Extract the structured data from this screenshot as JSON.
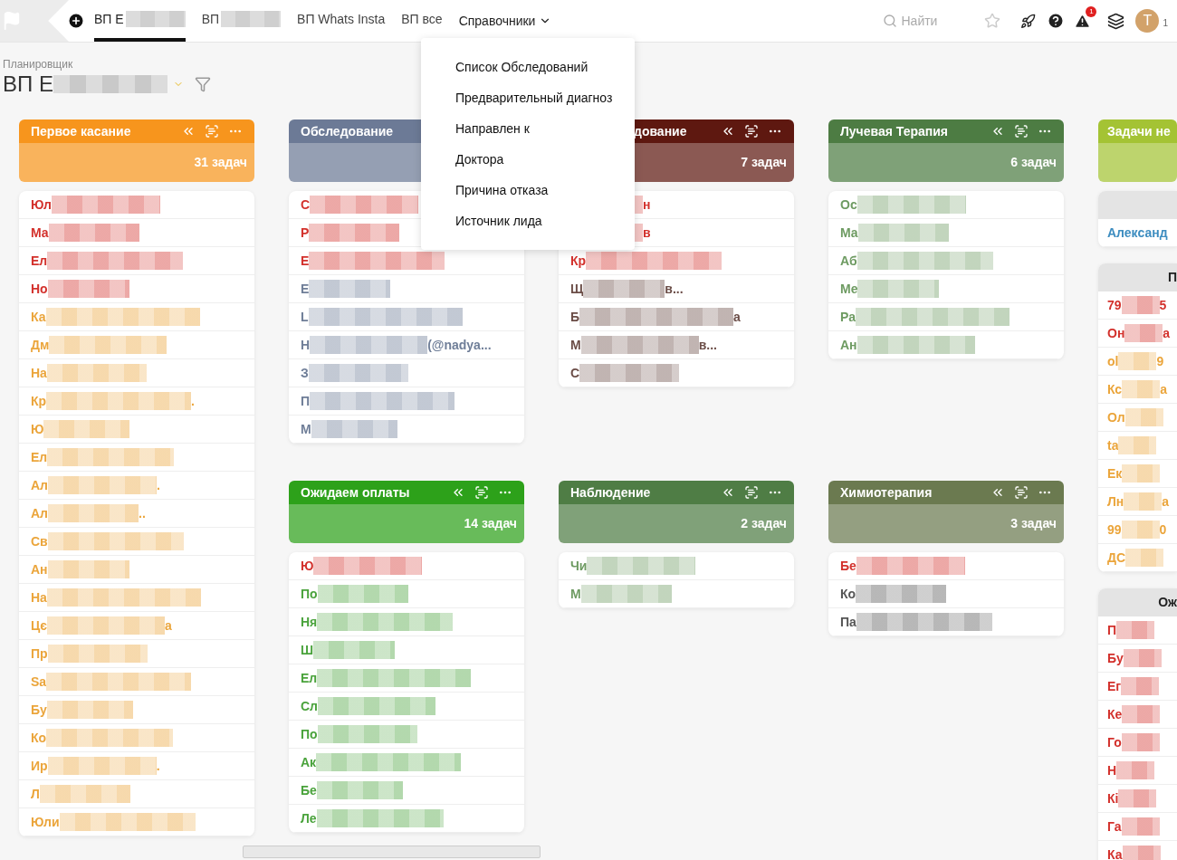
{
  "nav": {
    "tabs": [
      {
        "label": "ВП Е",
        "selected": true,
        "masked": true
      },
      {
        "label": "ВП",
        "selected": false,
        "masked": true
      },
      {
        "label": "ВП Whats Insta",
        "selected": false,
        "masked": false
      },
      {
        "label": "ВП все",
        "selected": false,
        "masked": false
      }
    ],
    "menu_label": "Справочники",
    "menu_open": true,
    "search_placeholder": "Найти",
    "alert_badge": "1",
    "avatar": "T",
    "user_count": "1"
  },
  "planner": {
    "caption": "Планировщик",
    "title": "ВП Е",
    "masked": true
  },
  "dropdown": {
    "items": [
      "Список Обследований",
      "Предварительный диагноз",
      "Направлен к",
      "Доктора",
      "Причина отказа",
      "Источник лида"
    ]
  },
  "columns": [
    {
      "stacks": [
        {
          "kind": "stage",
          "title": "Первое касание",
          "count": "31 задач",
          "color": "#f7951d",
          "rows": [
            {
              "text": "Юл",
              "color": "#d3312c",
              "masked": true
            },
            {
              "text": "Ма",
              "color": "#d3312c",
              "masked": true
            },
            {
              "text": "Ел",
              "color": "#d3312c",
              "masked": true
            },
            {
              "text": "Но",
              "color": "#d3312c",
              "masked": true
            },
            {
              "text": "Ка",
              "color": "#eba53b",
              "masked": true
            },
            {
              "text": "Дм",
              "color": "#eba53b",
              "masked": true
            },
            {
              "text": "На",
              "color": "#eba53b",
              "masked": true
            },
            {
              "text": "Кр",
              "color": "#eba53b",
              "masked": true,
              "tail": "."
            },
            {
              "text": "Ю",
              "color": "#eba53b",
              "masked": true
            },
            {
              "text": "Ел",
              "color": "#eba53b",
              "masked": true
            },
            {
              "text": "Ал",
              "color": "#eba53b",
              "masked": true,
              "tail": "."
            },
            {
              "text": "Ал",
              "color": "#eba53b",
              "masked": true,
              "tail": ".."
            },
            {
              "text": "Св",
              "color": "#eba53b",
              "masked": true
            },
            {
              "text": "Ан",
              "color": "#eba53b",
              "masked": true
            },
            {
              "text": "На",
              "color": "#eba53b",
              "masked": true
            },
            {
              "text": "Цє",
              "color": "#eba53b",
              "masked": true,
              "tail": "а"
            },
            {
              "text": "Пр",
              "color": "#eba53b",
              "masked": true
            },
            {
              "text": "Sa",
              "color": "#eba53b",
              "masked": true
            },
            {
              "text": "Бу",
              "color": "#eba53b",
              "masked": true
            },
            {
              "text": "Ко",
              "color": "#eba53b",
              "masked": true
            },
            {
              "text": "Ир",
              "color": "#eba53b",
              "masked": true,
              "tail": "."
            },
            {
              "text": "Л",
              "color": "#eba53b",
              "masked": true
            },
            {
              "text": "Юли",
              "color": "#eba53b",
              "masked": true
            }
          ]
        }
      ]
    },
    {
      "stacks": [
        {
          "kind": "stage",
          "title": "Обследование",
          "color": "#6c7a96",
          "rows": [
            {
              "text": "С",
              "color": "#d3312c",
              "masked": true
            },
            {
              "text": "Р",
              "color": "#d3312c",
              "masked": true
            },
            {
              "text": "Е",
              "color": "#d3312c",
              "masked": true
            },
            {
              "text": "Е",
              "color": "#6f7e98",
              "masked": true
            },
            {
              "text": "L",
              "color": "#6f7e98",
              "masked": true
            },
            {
              "text": "Н",
              "color": "#6f7e98",
              "masked": true,
              "tail": "(@nadya..."
            },
            {
              "text": "З",
              "color": "#6f7e98",
              "masked": true
            },
            {
              "text": "П",
              "color": "#6f7e98",
              "masked": true
            },
            {
              "text": "М",
              "color": "#6f7e98",
              "masked": true
            }
          ]
        },
        {
          "kind": "stage",
          "title": "Ожидаем оплаты",
          "count": "14 задач",
          "color": "#2da11a",
          "rows": [
            {
              "text": "Ю",
              "color": "#d3312c",
              "masked": true
            },
            {
              "text": "По",
              "color": "#4aa33c",
              "masked": true
            },
            {
              "text": "Ня",
              "color": "#4aa33c",
              "masked": true
            },
            {
              "text": "Ш",
              "color": "#4aa33c",
              "masked": true
            },
            {
              "text": "Ел",
              "color": "#4aa33c",
              "masked": true
            },
            {
              "text": "Сл",
              "color": "#4aa33c",
              "masked": true
            },
            {
              "text": "По",
              "color": "#4aa33c",
              "masked": true
            },
            {
              "text": "Ак",
              "color": "#4aa33c",
              "masked": true
            },
            {
              "text": "Бе",
              "color": "#4aa33c",
              "masked": true
            },
            {
              "text": "Ле",
              "color": "#4aa33c",
              "masked": true
            }
          ]
        }
      ]
    },
    {
      "stacks": [
        {
          "kind": "stage",
          "title": "дование",
          "count": "7 задач",
          "color": "#5e1810",
          "covered": true,
          "rows": [
            {
              "color": "#d3312c",
              "masked": true,
              "tail": "н"
            },
            {
              "color": "#d3312c",
              "masked": true,
              "tail": "в"
            },
            {
              "text": "Кр",
              "color": "#d3312c",
              "masked": true
            },
            {
              "text": "Щ",
              "color": "#6b4d47",
              "masked": true,
              "tail": "в..."
            },
            {
              "text": "Б",
              "color": "#6b4d47",
              "masked": true,
              "tail": "а"
            },
            {
              "text": "М",
              "color": "#6b4d47",
              "masked": true,
              "tail": "в..."
            },
            {
              "text": "С",
              "color": "#6b4d47",
              "masked": true
            }
          ]
        },
        {
          "kind": "stage",
          "title": "Наблюдение",
          "count": "2 задач",
          "color": "#4f7d45",
          "rows": [
            {
              "text": "Чи",
              "color": "#6e9b62",
              "masked": true
            },
            {
              "text": "М",
              "color": "#6e9b62",
              "masked": true
            }
          ]
        }
      ]
    },
    {
      "stacks": [
        {
          "kind": "stage",
          "title": "Лучевая Терапия",
          "count": "6 задач",
          "color": "#4d7c43",
          "rows": [
            {
              "text": "Ос",
              "color": "#6e9b62",
              "masked": true
            },
            {
              "text": "Ма",
              "color": "#6e9b62",
              "masked": true
            },
            {
              "text": "Аб",
              "color": "#6e9b62",
              "masked": true
            },
            {
              "text": "Ме",
              "color": "#6e9b62",
              "masked": true
            },
            {
              "text": "Ра",
              "color": "#6e9b62",
              "masked": true
            },
            {
              "text": "Ан",
              "color": "#6e9b62",
              "masked": true
            }
          ]
        },
        {
          "kind": "stage",
          "title": "Химиотерапия",
          "count": "3 задач",
          "color": "#6b7a50",
          "rows": [
            {
              "text": "Бе",
              "color": "#d3312c",
              "masked": true
            },
            {
              "text": "Ко",
              "color": "#555555",
              "masked": true
            },
            {
              "text": "Па",
              "color": "#555555",
              "masked": true
            }
          ]
        }
      ]
    },
    {
      "narrow": true,
      "stacks": [
        {
          "kind": "grouped",
          "title": "Задачи не",
          "color": "#a4c334",
          "groups": [
            {
              "rows": [
                {
                  "text": "Александ",
                  "color": "#3d8dc0",
                  "masked": false
                }
              ]
            },
            {
              "heading": "П",
              "rows": [
                {
                  "text": "79",
                  "color": "#d3312c",
                  "masked": true,
                  "tail": "5"
                },
                {
                  "text": "Он",
                  "color": "#d3312c",
                  "masked": true,
                  "tail": "а"
                },
                {
                  "text": "оl",
                  "color": "#eba53b",
                  "masked": true,
                  "tail": "9"
                },
                {
                  "text": "Кс",
                  "color": "#eba53b",
                  "masked": true,
                  "tail": "а"
                },
                {
                  "text": "Ол",
                  "color": "#eba53b",
                  "masked": true
                },
                {
                  "text": "ta",
                  "color": "#eba53b",
                  "masked": true
                },
                {
                  "text": "Ек",
                  "color": "#eba53b",
                  "masked": true
                },
                {
                  "text": "Лн",
                  "color": "#eba53b",
                  "masked": true,
                  "tail": "а"
                },
                {
                  "text": "99",
                  "color": "#eba53b",
                  "masked": true,
                  "tail": "0"
                },
                {
                  "text": "ДС",
                  "color": "#eba53b",
                  "masked": true
                }
              ]
            },
            {
              "heading": "Ож",
              "rows": [
                {
                  "text": "П",
                  "color": "#d3312c",
                  "masked": true
                },
                {
                  "text": "Бу",
                  "color": "#d3312c",
                  "masked": true
                },
                {
                  "text": "Ег",
                  "color": "#d3312c",
                  "masked": true
                },
                {
                  "text": "Ке",
                  "color": "#d3312c",
                  "masked": true
                },
                {
                  "text": "Го",
                  "color": "#d3312c",
                  "masked": true
                },
                {
                  "text": "Н",
                  "color": "#d3312c",
                  "masked": true
                },
                {
                  "text": "Кі",
                  "color": "#d3312c",
                  "masked": true
                },
                {
                  "text": "Га",
                  "color": "#d3312c",
                  "masked": true
                },
                {
                  "text": "Ка",
                  "color": "#d3312c",
                  "masked": true
                }
              ]
            }
          ]
        }
      ]
    }
  ]
}
